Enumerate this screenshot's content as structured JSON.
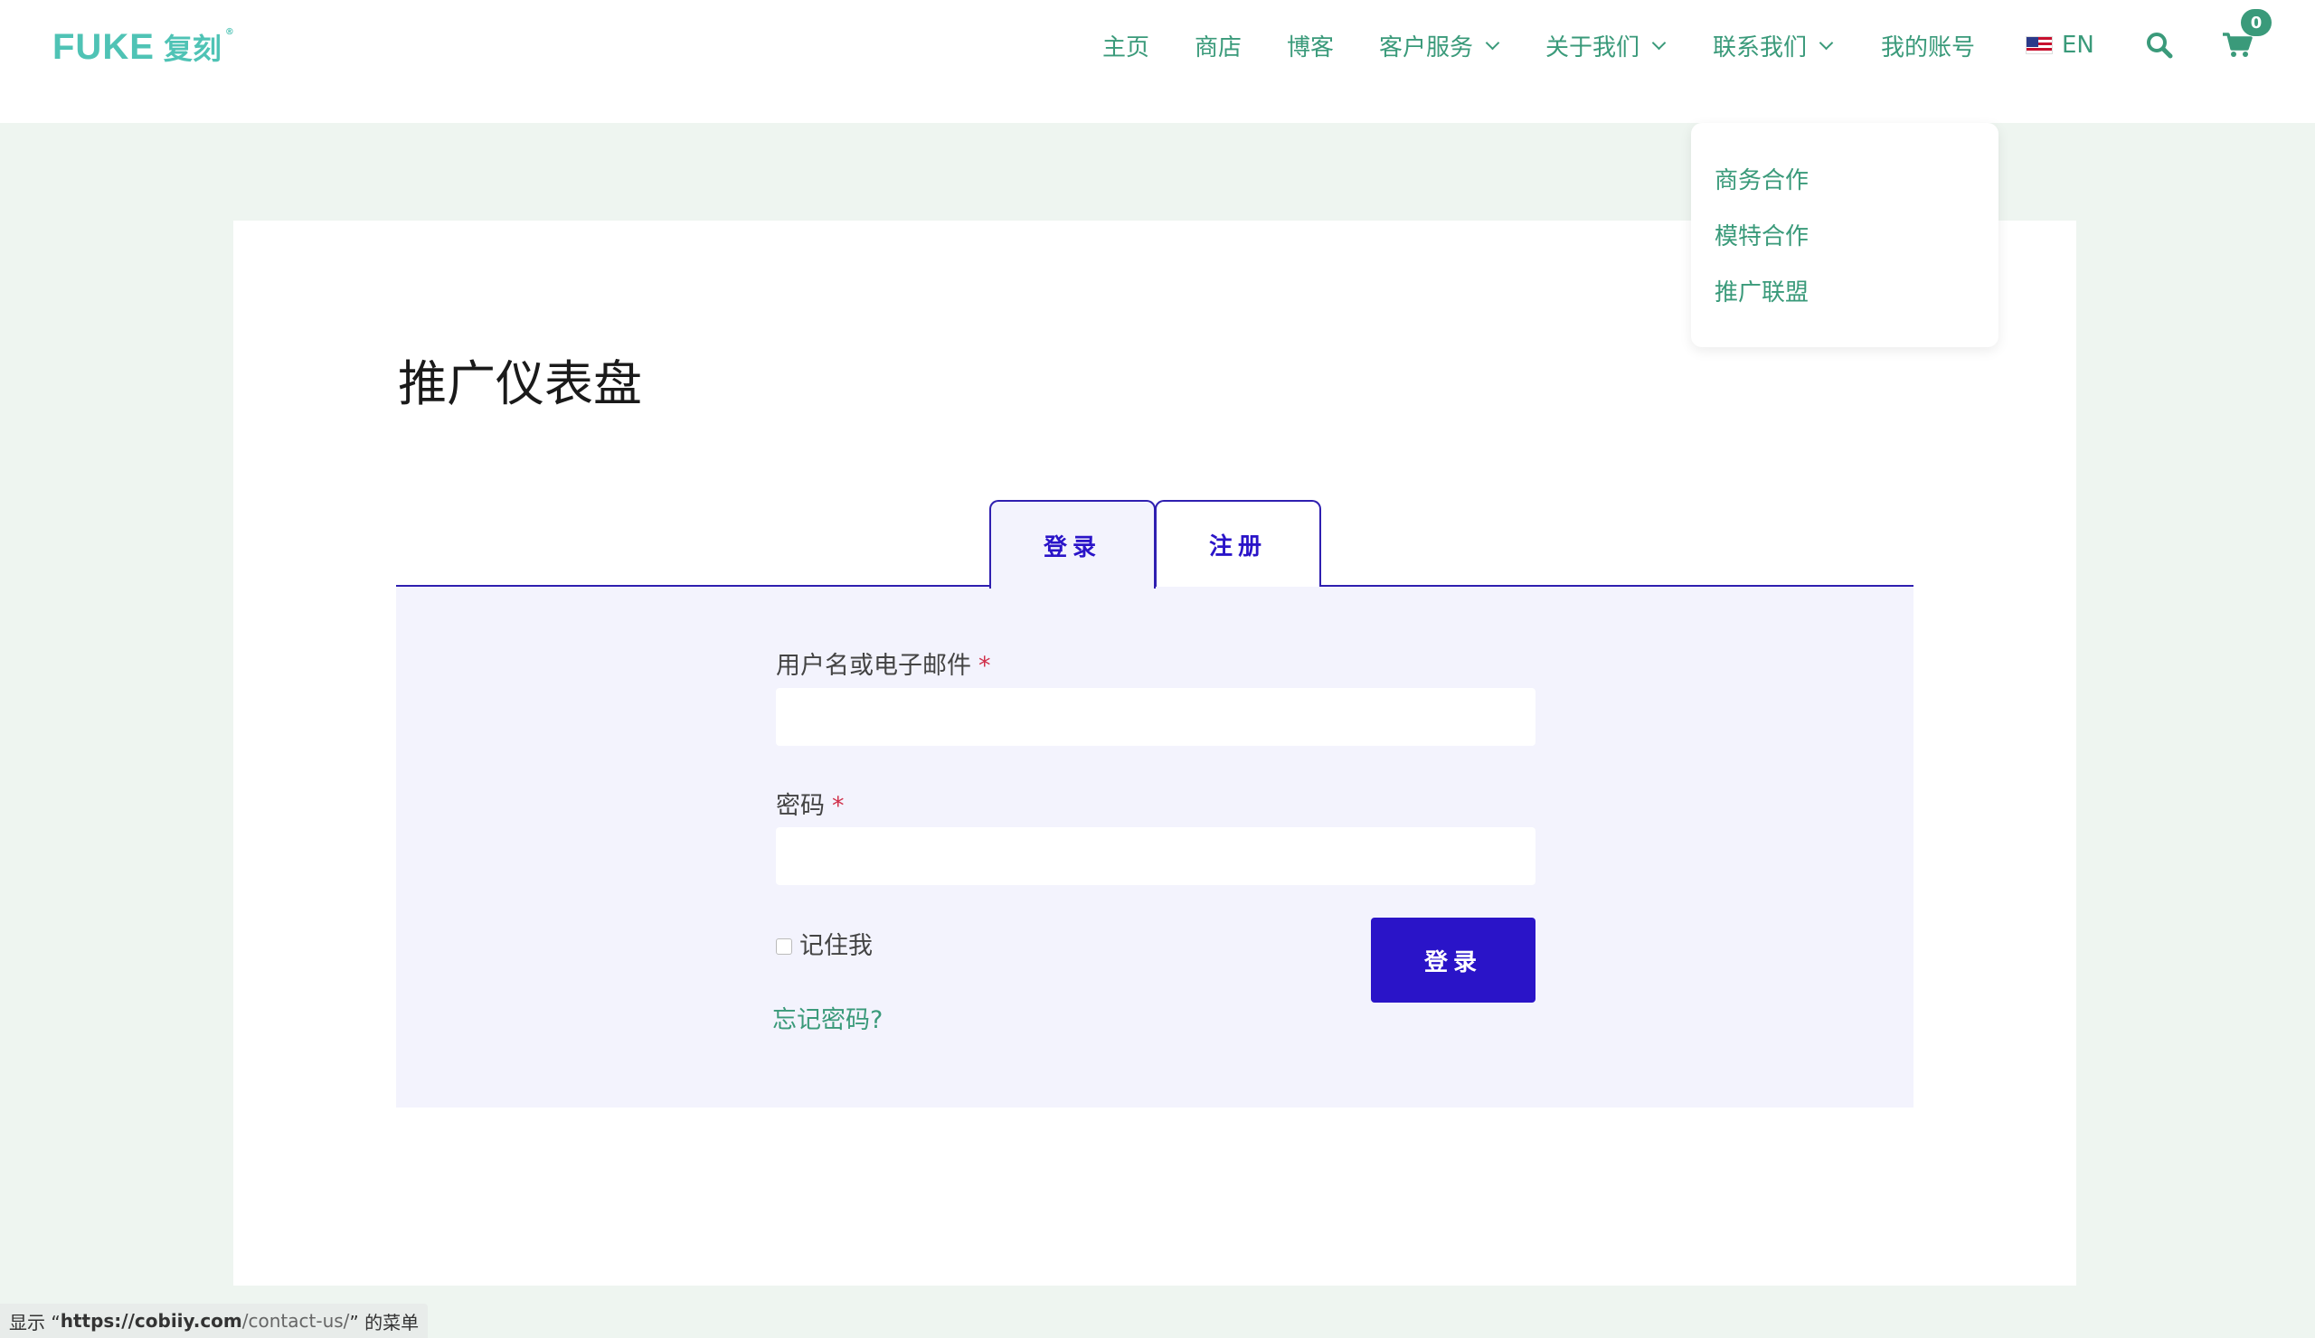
{
  "brand": {
    "latin": "FUKE",
    "cn": "复刻",
    "mark": "®"
  },
  "nav": {
    "home": "主页",
    "shop": "商店",
    "blog": "博客",
    "customer_service": "客户服务",
    "about_us": "关于我们",
    "contact_us": "联系我们",
    "my_account": "我的账号",
    "language": "EN",
    "cart_count": "0"
  },
  "dropdown": {
    "items": [
      "商务合作",
      "模特合作",
      "推广联盟"
    ]
  },
  "page": {
    "title": "推广仪表盘"
  },
  "tabs": {
    "login": "登录",
    "register": "注册",
    "active": "login"
  },
  "form": {
    "username_label": "用户名或电子邮件",
    "password_label": "密码",
    "required_mark": "*",
    "username_value": "",
    "password_value": "",
    "remember_label": "记住我",
    "remember_checked": false,
    "submit_label": "登录",
    "forgot_label": "忘记密码?"
  },
  "status_bar": {
    "prefix": "显示 “",
    "url_host": "https://cobiiy.com",
    "url_path": "/contact-us/",
    "suffix": "” 的菜单"
  },
  "colors": {
    "brand_green": "#3a9a7a",
    "logo_teal": "#4fc3b5",
    "accent_blue": "#2a14c8",
    "page_bg": "#eef5f0",
    "panel_bg": "#f3f3fd",
    "required_red": "#d0304a"
  }
}
